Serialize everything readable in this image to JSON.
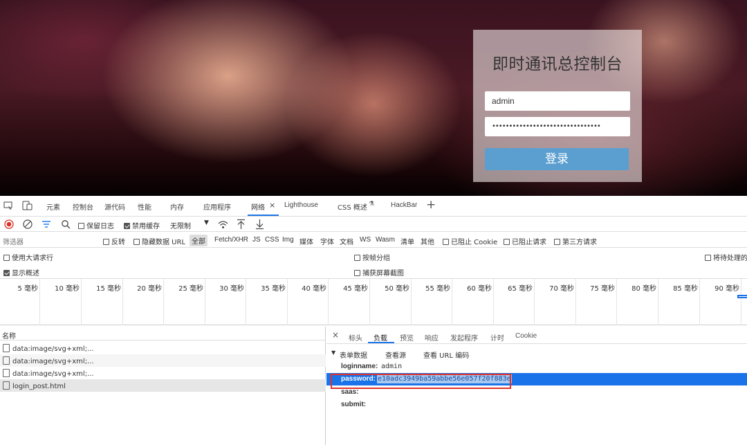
{
  "login": {
    "title": "即时通讯总控制台",
    "username_value": "admin",
    "password_masked": "••••••••••••••••••••••••••••••••",
    "login_button": "登录"
  },
  "devtools": {
    "tabs": [
      "元素",
      "控制台",
      "源代码",
      "性能",
      "内存",
      "应用程序",
      "网络",
      "Lighthouse",
      "CSS 概述",
      "HackBar"
    ],
    "toolbar": {
      "preserve_log": "保留日志",
      "disable_cache": "禁用缓存",
      "throttle": "无限制"
    },
    "filter": {
      "placeholder": "筛选器",
      "invert": "反转",
      "hide_data_url": "隐藏数据 URL",
      "all": "全部",
      "types": [
        "Fetch/XHR",
        "JS",
        "CSS",
        "Img",
        "媒体",
        "字体",
        "文档",
        "WS",
        "Wasm",
        "清单",
        "其他"
      ],
      "blocked_cookies": "已阻止 Cookie",
      "blocked_requests": "已阻止请求",
      "third_party": "第三方请求"
    },
    "options": {
      "large_rows": "使用大请求行",
      "group_by_frame": "按帧分组",
      "pending": "将待处理的",
      "show_overview": "显示概述",
      "capture_screenshots": "捕获屏幕截图"
    },
    "timeline_ticks": [
      "5 毫秒",
      "10 毫秒",
      "15 毫秒",
      "20 毫秒",
      "25 毫秒",
      "30 毫秒",
      "35 毫秒",
      "40 毫秒",
      "45 毫秒",
      "50 毫秒",
      "55 毫秒",
      "60 毫秒",
      "65 毫秒",
      "70 毫秒",
      "75 毫秒",
      "80 毫秒",
      "85 毫秒",
      "90 毫秒"
    ],
    "requests": {
      "header": "名称",
      "rows": [
        "data:image/svg+xml;...",
        "data:image/svg+xml;...",
        "data:image/svg+xml;...",
        "login_post.html"
      ]
    },
    "detail": {
      "close": "×",
      "tabs": [
        "标头",
        "负载",
        "预览",
        "响应",
        "发起程序",
        "计时",
        "Cookie"
      ],
      "section": "表单数据",
      "view_source": "查看源",
      "view_url_encoded": "查看 URL 编码",
      "fields": [
        {
          "key": "loginname:",
          "value": "admin"
        },
        {
          "key": "password:",
          "value": "e10adc3949ba59abbe56e057f20f883e"
        },
        {
          "key": "saas:",
          "value": ""
        },
        {
          "key": "submit:",
          "value": ""
        }
      ]
    }
  }
}
